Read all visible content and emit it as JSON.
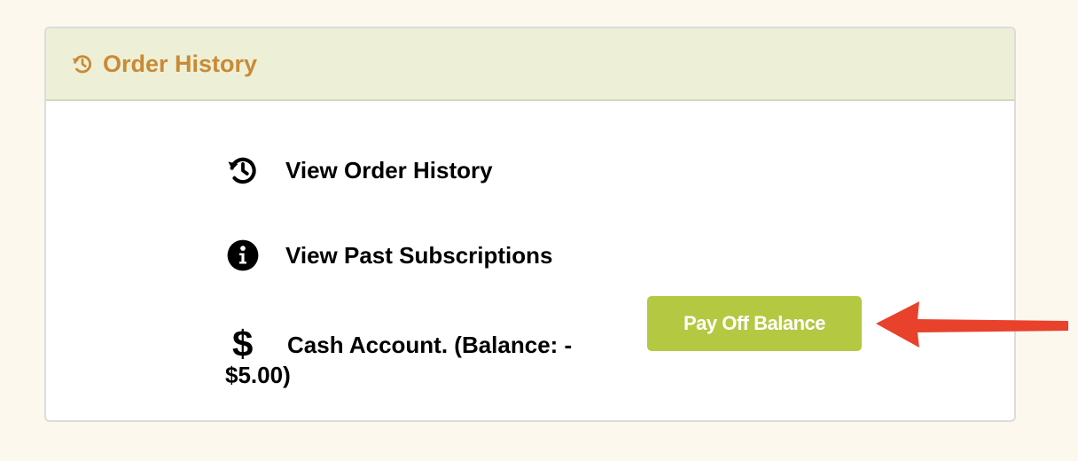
{
  "header": {
    "title": "Order History",
    "icon": "history-icon",
    "title_color": "#c98a35",
    "background": "#edf0d6"
  },
  "items": [
    {
      "label": "View Order History",
      "icon": "history-icon"
    },
    {
      "label": "View Past Subscriptions",
      "icon": "info-icon"
    }
  ],
  "cash": {
    "icon": "dollar-icon",
    "icon_glyph": "$",
    "label_line1": "Cash Account. (Balance: -",
    "label_line2": "$5.00)"
  },
  "pay_button": {
    "label": "Pay Off Balance",
    "color": "#b5c842"
  },
  "annotation": {
    "icon": "red-arrow-icon",
    "color": "#e8412c"
  }
}
